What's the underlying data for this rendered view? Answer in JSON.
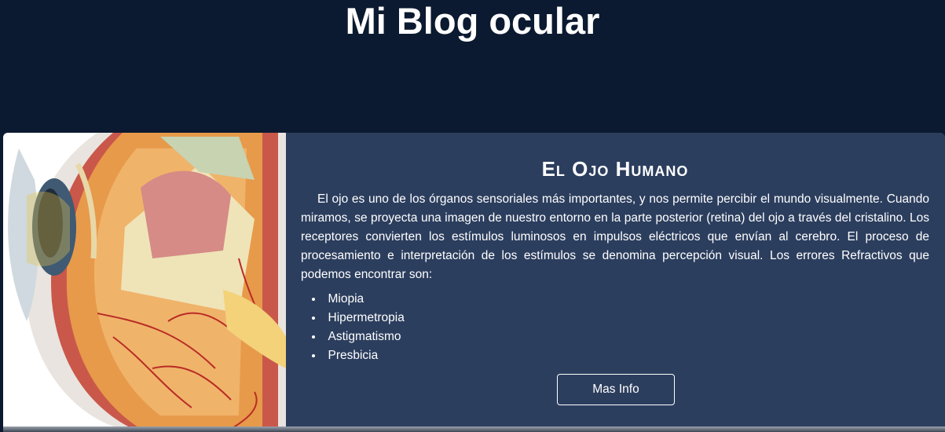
{
  "header": {
    "title": "Mi Blog ocular"
  },
  "article": {
    "heading": "El Ojo Humano",
    "body": "El ojo es uno de los órganos sensoriales más importantes, y nos permite percibir el mundo visualmente. Cuando miramos, se proyecta una imagen de nuestro entorno en la parte posterior (retina) del ojo a través del cristalino. Los receptores convierten los estímulos luminosos en impulsos eléctricos que envían al cerebro. El proceso de procesamiento e interpretación de los estímulos se denomina percepción visual. Los errores Refractivos que podemos encontrar son:",
    "errors": [
      "Miopia",
      "Hipermetropia",
      "Astigmatismo",
      "Presbicia"
    ],
    "button_label": "Mas Info"
  },
  "colors": {
    "background": "#0b1a30",
    "card": "#2c3e5e",
    "text": "#ffffff"
  }
}
